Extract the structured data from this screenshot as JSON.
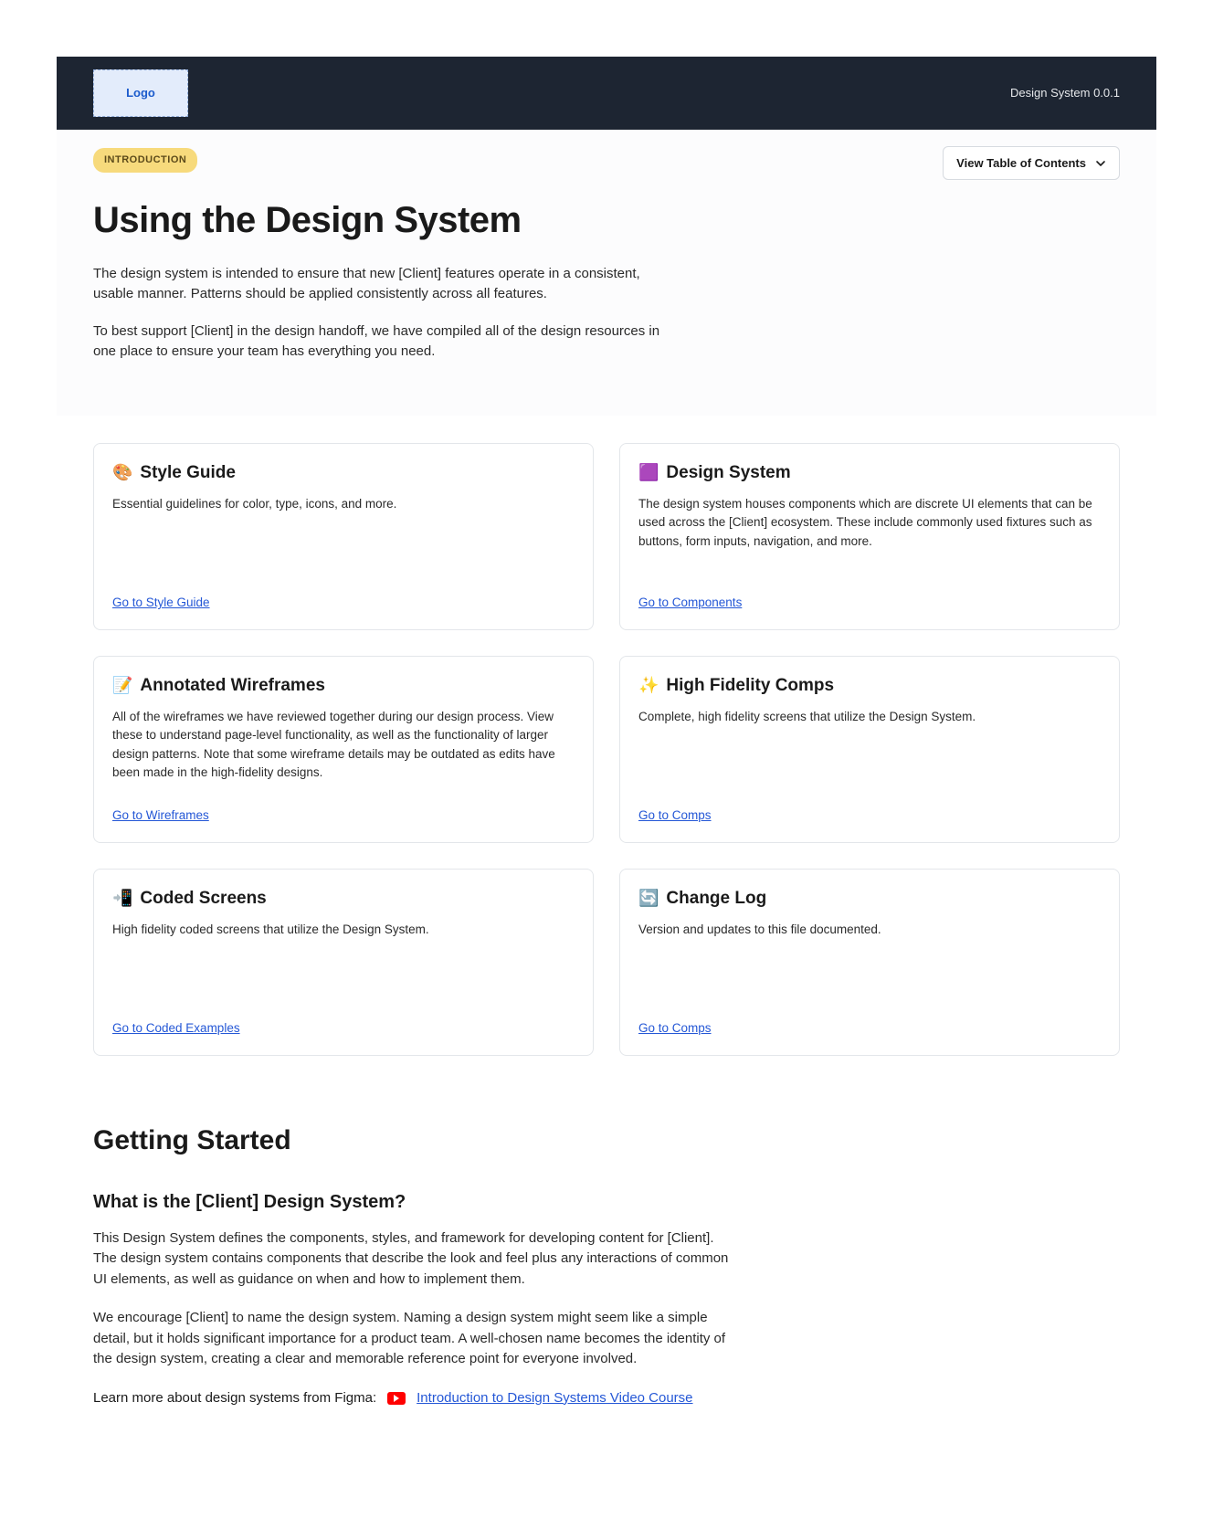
{
  "header": {
    "logo_label": "Logo",
    "version": "Design System 0.0.1"
  },
  "intro": {
    "badge": "INTRODUCTION",
    "toc_button": "View Table of Contents",
    "title": "Using the Design System",
    "para1": "The design system is intended to ensure that new [Client] features operate in a consistent, usable manner. Patterns should be applied consistently across all features.",
    "para2": "To best support [Client] in the design handoff, we have compiled all of the design resources in one place to ensure your team has everything you need."
  },
  "cards": [
    {
      "icon": "🎨",
      "title": "Style Guide",
      "desc": "Essential guidelines for color, type, icons, and more.",
      "link": "Go to Style Guide"
    },
    {
      "icon": "🟪",
      "title": "Design System",
      "desc": "The design system houses components which are discrete UI elements that can be used across the [Client] ecosystem. These include commonly used fixtures such as buttons, form inputs, navigation, and more.",
      "link": "Go to Components"
    },
    {
      "icon": "📝",
      "title": "Annotated Wireframes",
      "desc": "All of the wireframes we have reviewed together during our design process. View these to understand page-level functionality, as well as the functionality of larger design patterns. Note that some wireframe details may be outdated as edits have been made in the high-fidelity designs.",
      "link": "Go to Wireframes"
    },
    {
      "icon": "✨",
      "title": "High Fidelity Comps",
      "desc": "Complete, high fidelity screens that utilize the Design System.",
      "link": "Go to Comps"
    },
    {
      "icon": "📲",
      "title": "Coded Screens",
      "desc": "High fidelity coded screens that utilize the Design System.",
      "link": "Go to Coded Examples"
    },
    {
      "icon": "🔄",
      "title": "Change Log",
      "desc": "Version and updates to this file documented.",
      "link": "Go to Comps"
    }
  ],
  "getting_started": {
    "heading": "Getting Started",
    "subheading": "What is the [Client] Design System?",
    "para1": "This Design System defines the components, styles, and framework for developing content for [Client]. The design system contains components that describe the look and feel plus any interactions of common UI elements, as well as guidance on when and how to implement them.",
    "para2": "We encourage [Client] to name the design system. Naming a design system might seem like a simple detail, but it holds significant importance for a product team. A well-chosen name becomes the identity of the design system, creating a clear and memorable reference point for everyone involved.",
    "learn_label": "Learn more about design systems from Figma:",
    "learn_link": "Introduction to Design Systems Video Course"
  }
}
